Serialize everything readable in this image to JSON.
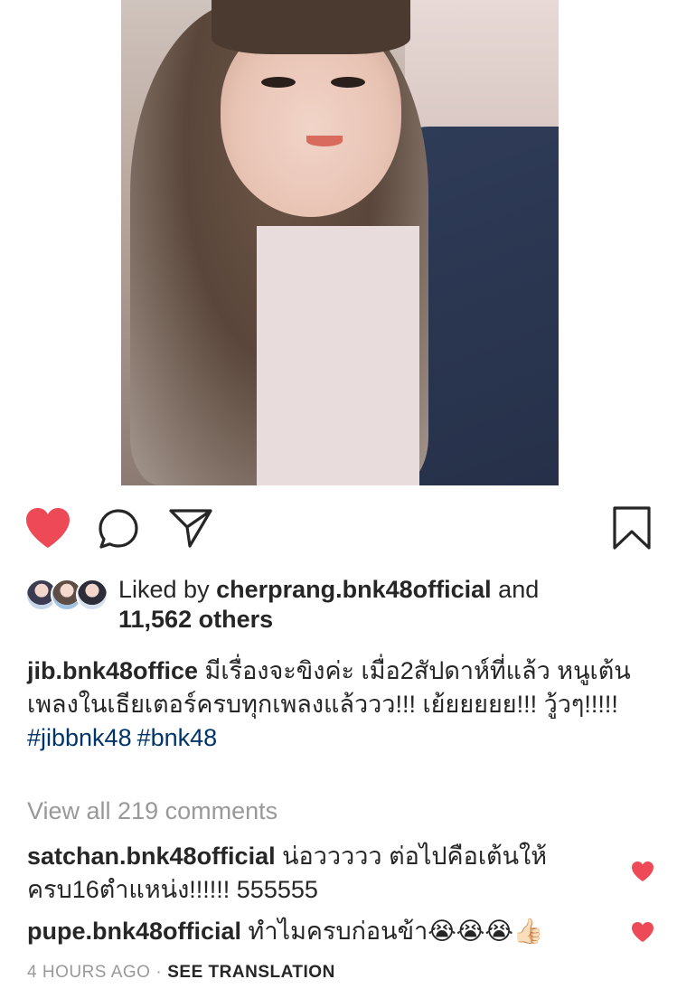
{
  "post": {
    "photo_icon": "selfie-photo"
  },
  "actions": {
    "like_icon": "heart-filled-icon",
    "like_color": "#ED4956",
    "comment_icon": "comment-bubble-icon",
    "share_icon": "paper-plane-icon",
    "save_icon": "bookmark-icon"
  },
  "likes": {
    "prefix": "Liked by ",
    "user": "cherprang.bnk48official",
    "joiner": " and",
    "count": "11,562 others"
  },
  "caption": {
    "username": "jib.bnk48office",
    "text": " มีเรื่องจะขิงค่ะ เมื่อ2สัปดาห์ที่แล้ว หนูเต้นเพลงในเธียเตอร์ครบทุกเพลงแล้ววว!!! เย้ยยยยย!!! วู้วๆ!!!!!",
    "hashtags": [
      "#jibbnk48",
      "#bnk48"
    ]
  },
  "view_all": "View all 219 comments",
  "comments": [
    {
      "username": "satchan.bnk48official",
      "text": " น่อววววว ต่อไปคือเต้นให้ครบ16ตำแหน่ง!!!!!! 555555"
    },
    {
      "username": "pupe.bnk48official",
      "text": " ทำไมครบก่อนข้า😭😭😭👍🏻"
    }
  ],
  "footer": {
    "time": "4 HOURS AGO",
    "separator": "·",
    "translate": "SEE TRANSLATION"
  }
}
